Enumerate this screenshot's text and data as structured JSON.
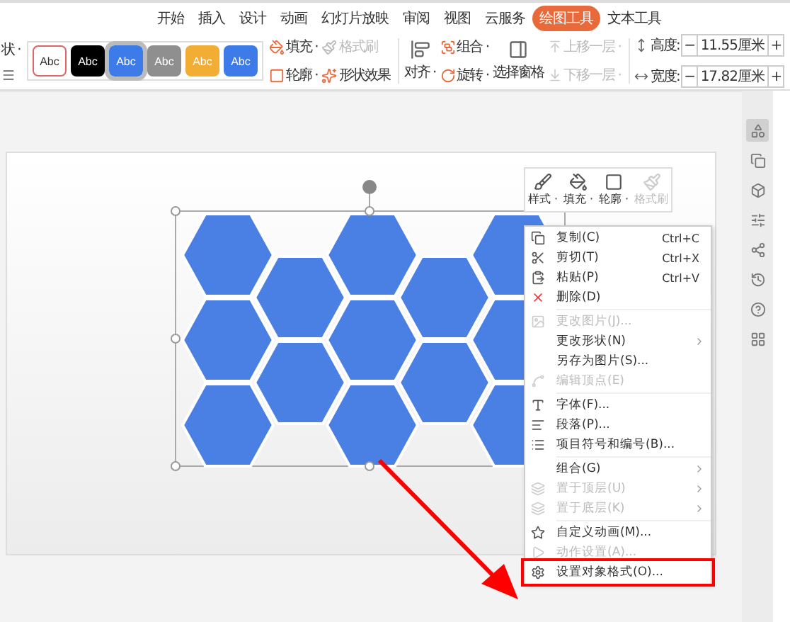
{
  "tabs": [
    {
      "label": "开始",
      "selected": false
    },
    {
      "label": "插入",
      "selected": false
    },
    {
      "label": "设计",
      "selected": false
    },
    {
      "label": "动画",
      "selected": false
    },
    {
      "label": "幻灯片放映",
      "selected": false
    },
    {
      "label": "审阅",
      "selected": false
    },
    {
      "label": "视图",
      "selected": false
    },
    {
      "label": "云服务",
      "selected": false
    },
    {
      "label": "绘图工具",
      "selected": true
    },
    {
      "label": "文本工具",
      "selected": false
    }
  ],
  "ribbon": {
    "left_fragment": "状 ·",
    "styles": [
      {
        "label": "Abc",
        "kind": "outline",
        "color": "#e06666",
        "selected": false
      },
      {
        "label": "Abc",
        "kind": "filled",
        "color": "#000000",
        "selected": false
      },
      {
        "label": "Abc",
        "kind": "filled",
        "color": "#3d7be8",
        "selected": true
      },
      {
        "label": "Abc",
        "kind": "filled",
        "color": "#8f8f8f",
        "selected": false
      },
      {
        "label": "Abc",
        "kind": "filled",
        "color": "#f2ae34",
        "selected": false
      },
      {
        "label": "Abc",
        "kind": "filled",
        "color": "#3d7be8",
        "selected": false
      }
    ],
    "shape_tools": [
      {
        "label": "填充 ·",
        "kind": "fill",
        "disabled": false
      },
      {
        "label": "格式刷",
        "kind": "brush",
        "disabled": true
      },
      {
        "label": "轮廓 ·",
        "kind": "outline",
        "disabled": false
      },
      {
        "label": "形状效果",
        "kind": "effect",
        "disabled": false
      }
    ],
    "align": "对齐 ·",
    "arrange": [
      {
        "label": "组合 ·",
        "kind": "group",
        "disabled": false
      },
      {
        "label": "旋转 ·",
        "kind": "rotate",
        "disabled": false
      }
    ],
    "selection_pane": "选择窗格",
    "layers": [
      {
        "label": "上移一层 ·",
        "disabled": true
      },
      {
        "label": "下移一层 ·",
        "disabled": true
      }
    ],
    "size": [
      {
        "label": "高度:",
        "value": "11.55厘米",
        "minus": "−",
        "plus": "+"
      },
      {
        "label": "宽度:",
        "value": "17.82厘米",
        "minus": "−",
        "plus": "+"
      }
    ]
  },
  "mini_toolbar": [
    {
      "label": "样式 ·",
      "kind": "style",
      "disabled": false
    },
    {
      "label": "填充 ·",
      "kind": "fill",
      "disabled": false
    },
    {
      "label": "轮廓 ·",
      "kind": "outline",
      "disabled": false
    },
    {
      "label": "格式刷",
      "kind": "brush",
      "disabled": true
    }
  ],
  "context_menu": [
    {
      "label": "复制(C)",
      "shortcut": "Ctrl+C",
      "kind": "copy",
      "disabled": false,
      "submenu": false
    },
    {
      "label": "剪切(T)",
      "shortcut": "Ctrl+X",
      "kind": "cut",
      "disabled": false,
      "submenu": false
    },
    {
      "label": "粘贴(P)",
      "shortcut": "Ctrl+V",
      "kind": "paste",
      "disabled": false,
      "submenu": false
    },
    {
      "label": "删除(D)",
      "kind": "delete",
      "disabled": false,
      "submenu": false
    },
    {
      "kind": "separator"
    },
    {
      "label": "更改图片(J)...",
      "kind": "picture",
      "disabled": true,
      "submenu": false
    },
    {
      "label": "更改形状(N)",
      "kind": "plain",
      "disabled": false,
      "submenu": true
    },
    {
      "label": "另存为图片(S)...",
      "kind": "plain",
      "disabled": false,
      "submenu": false
    },
    {
      "label": "编辑顶点(E)",
      "kind": "vertex",
      "disabled": true,
      "submenu": false
    },
    {
      "kind": "separator"
    },
    {
      "label": "字体(F)...",
      "kind": "font",
      "disabled": false,
      "submenu": false
    },
    {
      "label": "段落(P)...",
      "kind": "paragraph",
      "disabled": false,
      "submenu": false
    },
    {
      "label": "项目符号和编号(B)...",
      "kind": "list",
      "disabled": false,
      "submenu": false
    },
    {
      "kind": "separator"
    },
    {
      "label": "组合(G)",
      "kind": "plain",
      "disabled": false,
      "submenu": true
    },
    {
      "label": "置于顶层(U)",
      "kind": "top",
      "disabled": true,
      "submenu": true
    },
    {
      "label": "置于底层(K)",
      "kind": "bottom",
      "disabled": true,
      "submenu": true
    },
    {
      "kind": "separator"
    },
    {
      "label": "自定义动画(M)...",
      "kind": "animation",
      "disabled": false,
      "submenu": false
    },
    {
      "label": "动作设置(A)...",
      "kind": "action",
      "disabled": true,
      "submenu": false
    },
    {
      "label": "设置对象格式(O)...",
      "kind": "format",
      "disabled": false,
      "submenu": false,
      "highlighted": true
    }
  ],
  "side_panel": [
    {
      "kind": "shapes",
      "selected": true
    },
    {
      "kind": "copy",
      "selected": false
    },
    {
      "kind": "box",
      "selected": false
    },
    {
      "kind": "sliders",
      "selected": false
    },
    {
      "kind": "share",
      "selected": false
    },
    {
      "kind": "history",
      "selected": false
    },
    {
      "kind": "help",
      "selected": false
    },
    {
      "kind": "grid",
      "selected": false
    }
  ]
}
